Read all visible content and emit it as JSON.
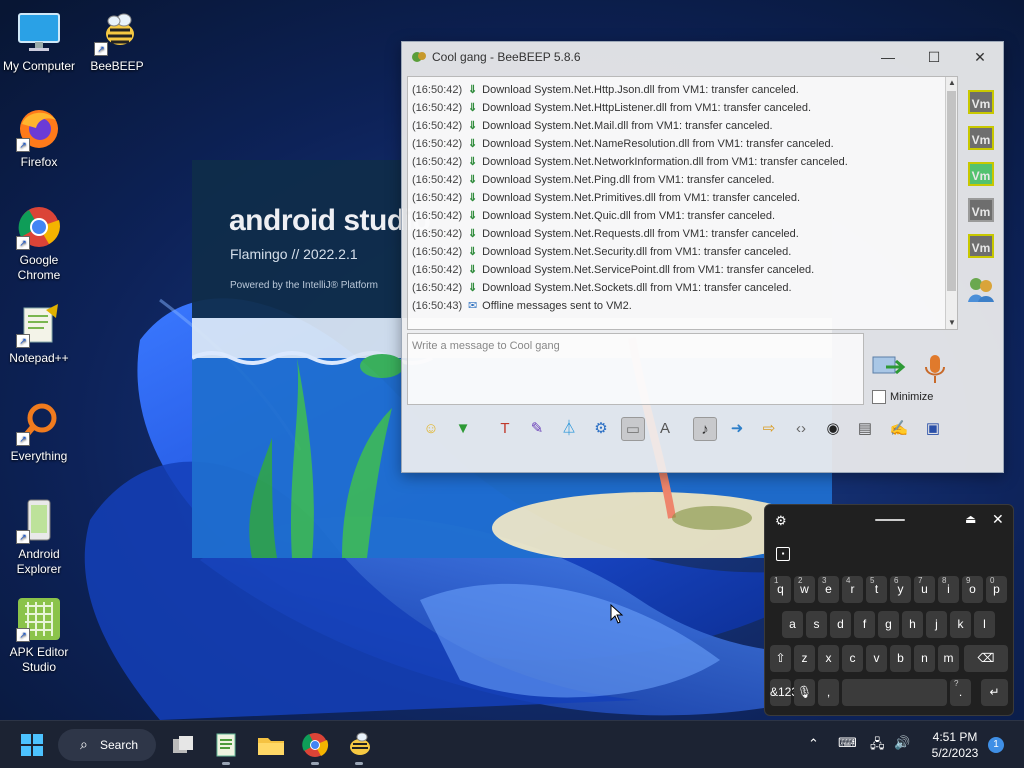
{
  "desktop": {
    "icons": [
      {
        "label": "My Computer"
      },
      {
        "label": "BeeBEEP"
      },
      {
        "label": "Firefox"
      },
      {
        "label": "Google Chrome"
      },
      {
        "label": "Notepad++"
      },
      {
        "label": "Everything"
      },
      {
        "label": "Android Explorer"
      },
      {
        "label": "APK Editor Studio"
      }
    ]
  },
  "splash": {
    "brand": "android studio",
    "version": "Flamingo // 2022.2.1",
    "powered": "Powered by the IntelliJ® Platform"
  },
  "beebeep": {
    "title": "Cool gang - BeeBEEP 5.8.6",
    "messages": [
      {
        "time": "(16:50:42)",
        "icon": "download-icon",
        "text": "Download System.Net.Http.Json.dll from VM1: transfer canceled."
      },
      {
        "time": "(16:50:42)",
        "icon": "download-icon",
        "text": "Download System.Net.HttpListener.dll from VM1: transfer canceled."
      },
      {
        "time": "(16:50:42)",
        "icon": "download-icon",
        "text": "Download System.Net.Mail.dll from VM1: transfer canceled."
      },
      {
        "time": "(16:50:42)",
        "icon": "download-icon",
        "text": "Download System.Net.NameResolution.dll from VM1: transfer canceled."
      },
      {
        "time": "(16:50:42)",
        "icon": "download-icon",
        "text": "Download System.Net.NetworkInformation.dll from VM1: transfer canceled."
      },
      {
        "time": "(16:50:42)",
        "icon": "download-icon",
        "text": "Download System.Net.Ping.dll from VM1: transfer canceled."
      },
      {
        "time": "(16:50:42)",
        "icon": "download-icon",
        "text": "Download System.Net.Primitives.dll from VM1: transfer canceled."
      },
      {
        "time": "(16:50:42)",
        "icon": "download-icon",
        "text": "Download System.Net.Quic.dll from VM1: transfer canceled."
      },
      {
        "time": "(16:50:42)",
        "icon": "download-icon",
        "text": "Download System.Net.Requests.dll from VM1: transfer canceled."
      },
      {
        "time": "(16:50:42)",
        "icon": "download-icon",
        "text": "Download System.Net.Security.dll from VM1: transfer canceled."
      },
      {
        "time": "(16:50:42)",
        "icon": "download-icon",
        "text": "Download System.Net.ServicePoint.dll from VM1: transfer canceled."
      },
      {
        "time": "(16:50:42)",
        "icon": "download-icon",
        "text": "Download System.Net.Sockets.dll from VM1: transfer canceled."
      },
      {
        "time": "(16:50:43)",
        "icon": "envelope-icon",
        "text": "Offline messages sent to VM2."
      }
    ],
    "input_placeholder": "Write a message to Cool gang",
    "minimize_label": "Minimize",
    "users": [
      {
        "label": "Vm",
        "status": "away"
      },
      {
        "label": "Vm",
        "status": "away"
      },
      {
        "label": "Vm",
        "status": "online"
      },
      {
        "label": "Vm",
        "status": "offline"
      },
      {
        "label": "Vm",
        "status": "away"
      }
    ],
    "toolbar_icons": [
      "emoticon-icon",
      "inbox-icon",
      "font-icon",
      "color-picker-icon",
      "filter-icon",
      "settings-gear-icon",
      "screenshot-icon",
      "text-format-icon",
      "music-note-icon",
      "send-file-icon",
      "share-folder-icon",
      "code-icon",
      "camera-icon",
      "terminal-icon",
      "edit-note-icon",
      "save-icon"
    ]
  },
  "keyboard": {
    "row1": [
      {
        "k": "q",
        "n": "1"
      },
      {
        "k": "w",
        "n": "2"
      },
      {
        "k": "e",
        "n": "3"
      },
      {
        "k": "r",
        "n": "4"
      },
      {
        "k": "t",
        "n": "5"
      },
      {
        "k": "y",
        "n": "6"
      },
      {
        "k": "u",
        "n": "7"
      },
      {
        "k": "i",
        "n": "8"
      },
      {
        "k": "o",
        "n": "9"
      },
      {
        "k": "p",
        "n": "0"
      }
    ],
    "row2": [
      "a",
      "s",
      "d",
      "f",
      "g",
      "h",
      "j",
      "k",
      "l"
    ],
    "row3": [
      "z",
      "x",
      "c",
      "v",
      "b",
      "n",
      "m"
    ],
    "symbols_label": "&123",
    "comma": ",",
    "period": ".",
    "period_sup": "?"
  },
  "taskbar": {
    "search_label": "Search",
    "time": "4:51 PM",
    "date": "5/2/2023",
    "notification_count": "1"
  }
}
